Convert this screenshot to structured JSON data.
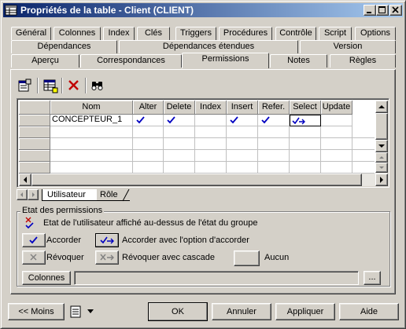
{
  "window": {
    "title": "Propriétés de la table - Client (CLIENT)"
  },
  "tabs": {
    "row1": [
      "Général",
      "Colonnes",
      "Index",
      "Clés",
      "Triggers",
      "Procédures",
      "Contrôle",
      "Script",
      "Options"
    ],
    "row2": [
      "Dépendances",
      "Dépendances étendues",
      "Version"
    ],
    "row3": [
      "Aperçu",
      "Correspondances",
      "Permissions",
      "Notes",
      "Règles"
    ],
    "active": "Permissions"
  },
  "toolbar": {
    "icons": [
      "properties-icon",
      "add-rows-icon",
      "delete-icon",
      "find-icon"
    ]
  },
  "grid": {
    "columns": [
      "Nom",
      "Alter",
      "Delete",
      "Index",
      "Insert",
      "Refer.",
      "Select",
      "Update"
    ],
    "rows": [
      {
        "nom": "CONCEPTEUR_1",
        "alter": "accorder",
        "delete": "accorder",
        "index": "",
        "insert": "accorder",
        "refer": "accorder",
        "select": "accorder-avec-option",
        "update": ""
      }
    ]
  },
  "subtabs": {
    "items": [
      "Utilisateur",
      "Rôle"
    ],
    "active": "Utilisateur"
  },
  "permissions_legend": {
    "group_title": "Etat des permissions",
    "user_over_group_text": "Etat de l'utilisateur affiché au-dessus de l'état du groupe",
    "accorder": "Accorder",
    "accorder_option": "Accorder avec l'option d'accorder",
    "revoquer": "Révoquer",
    "revoquer_cascade": "Révoquer avec cascade",
    "aucun": "Aucun",
    "colonnes_button": "Colonnes",
    "colonnes_value": "",
    "ellipsis_button": "..."
  },
  "footer": {
    "moins": "<< Moins",
    "ok": "OK",
    "annuler": "Annuler",
    "appliquer": "Appliquer",
    "aide": "Aide"
  },
  "colors": {
    "face": "#d4d0c8",
    "title_start": "#0a246a",
    "title_end": "#a6caf0",
    "check_blue": "#0000c0",
    "delete_red": "#c00000"
  }
}
